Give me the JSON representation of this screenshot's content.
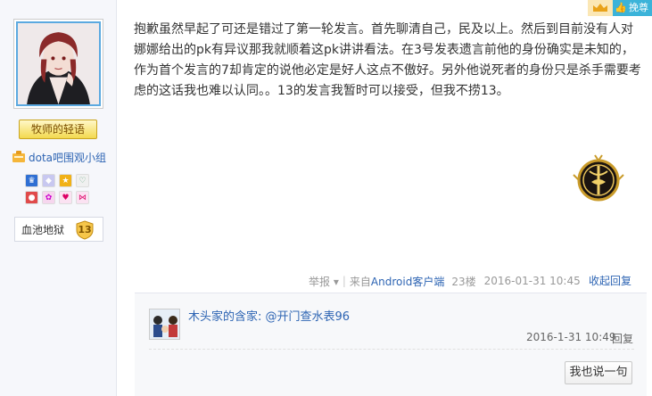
{
  "top": {
    "action_label": "挽尊"
  },
  "user": {
    "title_badge": "牧师的轻语",
    "group_name": "dota吧围观小组",
    "level_name": "血池地狱",
    "level_number": "13"
  },
  "post": {
    "text": "抱歉虽然早起了可还是错过了第一轮发言。首先聊清自己，民及以上。然后到目前没有人对娜娜给出的pk有异议那我就顺着这pk讲讲看法。在3号发表遗言前他的身份确实是未知的，作为首个发言的7却肯定的说他必定是好人这点不傲好。另外他说死者的身份只是杀手需要考虑的这话我也难以认同。。13的发言我暂时可以接受，但我不捞13。",
    "report_label": "举报",
    "source_prefix": "来自",
    "source_app": "Android客户端",
    "floor": "23楼",
    "datetime": "2016-01-31 10:45",
    "collapse_label": "收起回复"
  },
  "reply": {
    "username": "木头家的含家:",
    "mention": "@开门查水表96",
    "time": "2016-1-31 10:49",
    "reply_label": "回复",
    "say_button": "我也说一句"
  },
  "colors": {
    "link_blue": "#2d64b3",
    "badge_gold": "#f3d94f",
    "top_button": "#3bb3d9"
  }
}
